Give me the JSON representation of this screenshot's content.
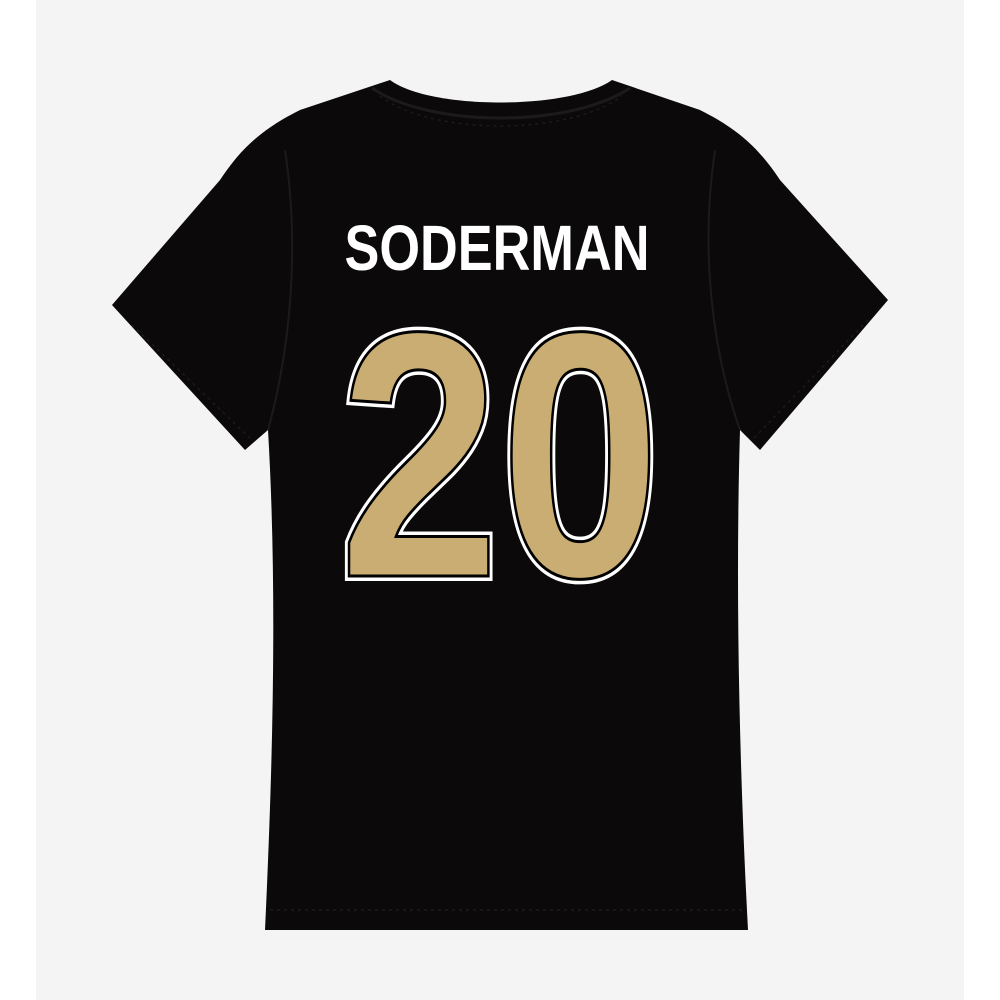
{
  "product": {
    "player_name": "SODERMAN",
    "player_number": "20"
  },
  "colors": {
    "page_background": "#ffffff",
    "backdrop": "#f4f4f4",
    "shirt": "#0b0909",
    "shirt_seam": "#1c1a1a",
    "name_fill": "#ffffff",
    "number_fill": "#c9ad72",
    "number_outline": "#ffffff",
    "number_outer": "#000000"
  }
}
